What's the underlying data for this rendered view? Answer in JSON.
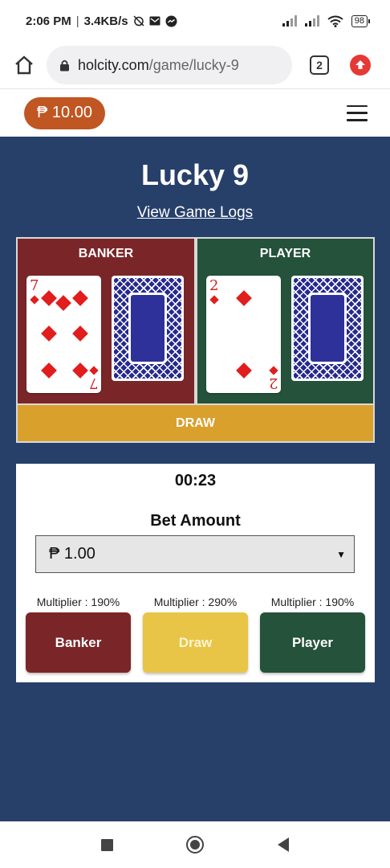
{
  "status_bar": {
    "time": "2:06 PM",
    "speed": "3.4KB/s",
    "battery": "98"
  },
  "browser": {
    "url_domain": "holcity.com",
    "url_path": "/game/lucky-9",
    "tab_count": "2"
  },
  "header": {
    "balance": "₱ 10.00"
  },
  "game": {
    "title": "Lucky 9",
    "logs_link": "View Game Logs",
    "banker_label": "BANKER",
    "player_label": "PLAYER",
    "banker_card_rank": "7",
    "player_card_rank": "2",
    "card_suit": "diamonds",
    "result_label": "DRAW"
  },
  "bet": {
    "timer": "00:23",
    "amount_label": "Bet Amount",
    "selected_amount": "₱ 1.00",
    "multipliers": {
      "banker": "Multiplier : 190%",
      "draw": "Multiplier : 290%",
      "player": "Multiplier : 190%"
    },
    "buttons": {
      "banker": "Banker",
      "draw": "Draw",
      "player": "Player"
    }
  },
  "colors": {
    "background": "#27406a",
    "banker": "#7a2628",
    "player": "#24523a",
    "draw": "#d9a02c",
    "balance_pill": "#c05621"
  }
}
